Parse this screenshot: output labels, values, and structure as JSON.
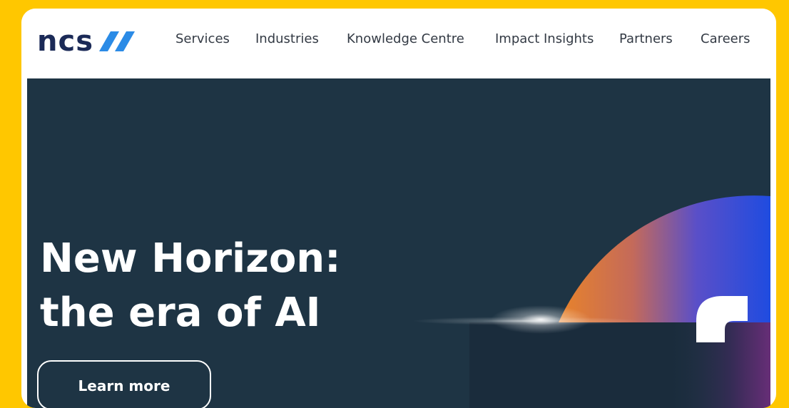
{
  "nav": {
    "logo_text": "ncs",
    "links": [
      "Services",
      "Industries",
      "Knowledge Centre",
      "Impact Insights",
      "Partners",
      "Careers"
    ]
  },
  "hero": {
    "title_line1": "New Horizon:",
    "title_line2": "the era of AI",
    "cta_label": "Learn more"
  },
  "colors": {
    "page_bg": "#FFC700",
    "brand_navy": "#1B2A57",
    "brand_blue": "#2B8BE6",
    "hero_bg": "#1E3444"
  }
}
